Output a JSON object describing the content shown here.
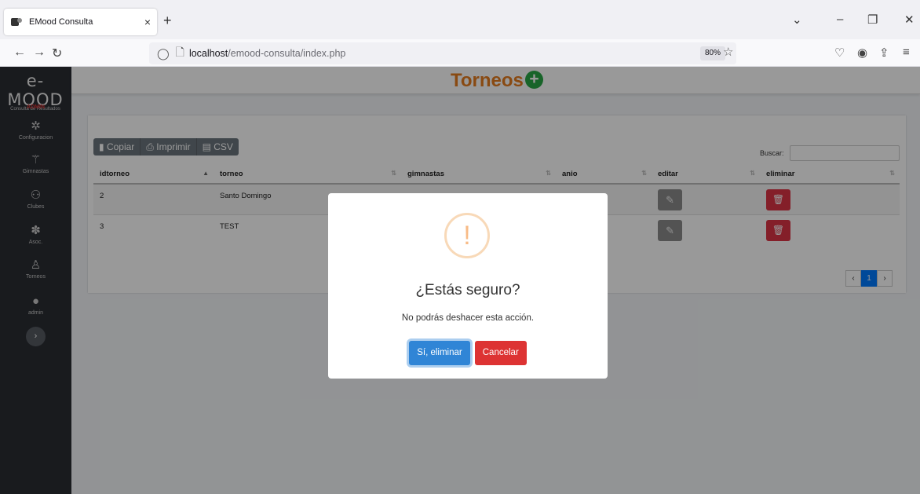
{
  "browser": {
    "tab_title": "EMood Consulta",
    "tab_close": "×",
    "newtab": "+",
    "url_host": "localhost",
    "url_path": "/emood-consulta/index.php",
    "zoom": "80%"
  },
  "app": {
    "logo": "e-MOOD",
    "logo_sub": "Consulta de Resultados",
    "role": "ADMIN",
    "sidebar": [
      {
        "label": "Configuracion",
        "icon": "gear-icon"
      },
      {
        "label": "Gimnastas",
        "icon": "gymnast-icon"
      },
      {
        "label": "Clubes",
        "icon": "clubs-icon"
      },
      {
        "label": "Asoc.",
        "icon": "association-icon"
      },
      {
        "label": "Torneos",
        "icon": "tournament-icon"
      },
      {
        "label": "admin",
        "icon": "user-icon"
      }
    ],
    "page_title": "Torneos",
    "toolbar": {
      "copy": "Copiar",
      "print": "Imprimir",
      "csv": "CSV"
    },
    "search_label": "Buscar:",
    "table": {
      "headers": [
        "idtorneo",
        "torneo",
        "gimnastas",
        "anio",
        "editar",
        "eliminar"
      ],
      "rows": [
        {
          "idtorneo": "2",
          "torneo": "Santo Domingo"
        },
        {
          "idtorneo": "3",
          "torneo": "TEST"
        }
      ]
    },
    "pagination": {
      "prev": "‹",
      "current": "1",
      "next": "›"
    }
  },
  "modal": {
    "icon": "!",
    "title": "¿Estás seguro?",
    "text": "No podrás deshacer esta acción.",
    "confirm": "Sí, eliminar",
    "cancel": "Cancelar"
  },
  "colors": {
    "title_orange": "#e57c1f",
    "sidebar_bg": "#2a2d33",
    "confirm_blue": "#3085d6",
    "cancel_red": "#dd3333",
    "add_green": "#28a745"
  }
}
